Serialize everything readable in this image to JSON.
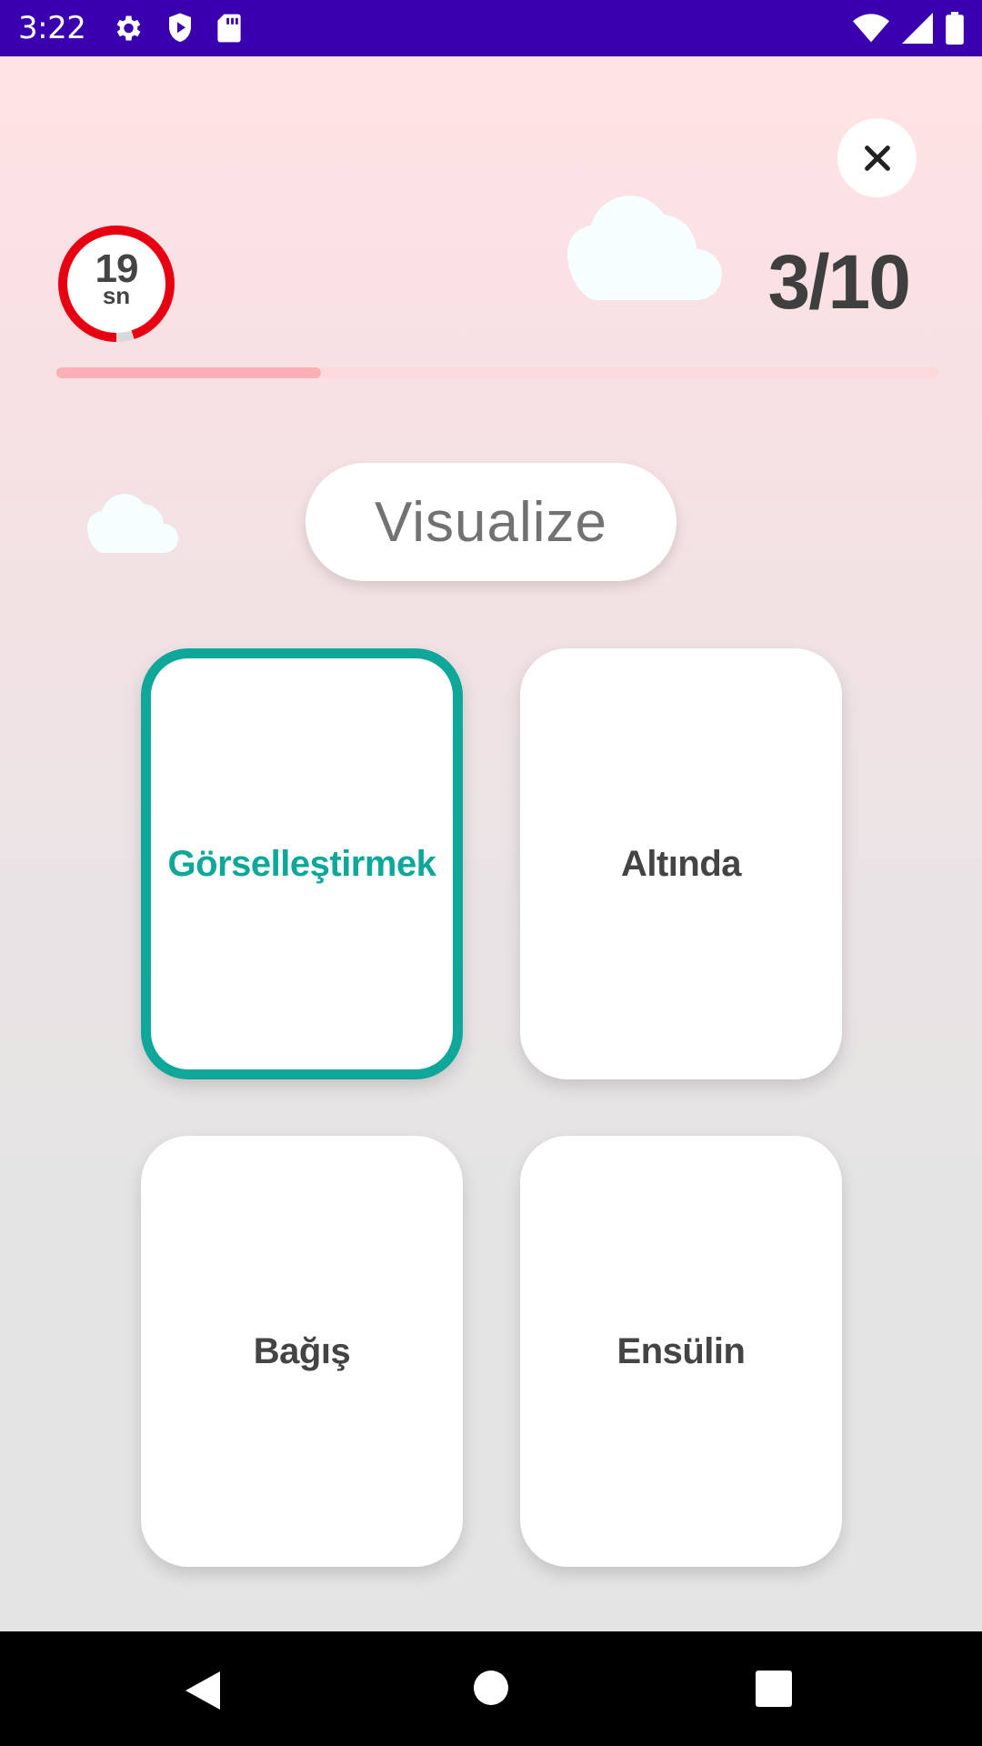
{
  "status_bar": {
    "time": "3:22",
    "icons": [
      "settings-icon",
      "shield-icon",
      "sd-card-icon",
      "wifi-icon",
      "signal-icon",
      "battery-icon"
    ]
  },
  "quiz": {
    "timer": {
      "seconds": "19",
      "unit": "sn",
      "remaining_fraction": 0.95
    },
    "progress": {
      "label": "3/10",
      "fraction": 0.3
    },
    "word": "Visualize",
    "options": [
      {
        "label": "Görselleştirmek",
        "selected": true
      },
      {
        "label": "Altında",
        "selected": false
      },
      {
        "label": "Bağış",
        "selected": false
      },
      {
        "label": "Ensülin",
        "selected": false
      }
    ]
  },
  "colors": {
    "status_bar": "#3a00b0",
    "accent": "#0ea79a",
    "timer_ring": "#e60012",
    "progress_fill": "#fab0b5",
    "progress_track": "#fbd9dc"
  },
  "nav": {
    "icons": [
      "back-icon",
      "home-icon",
      "recents-icon"
    ]
  }
}
